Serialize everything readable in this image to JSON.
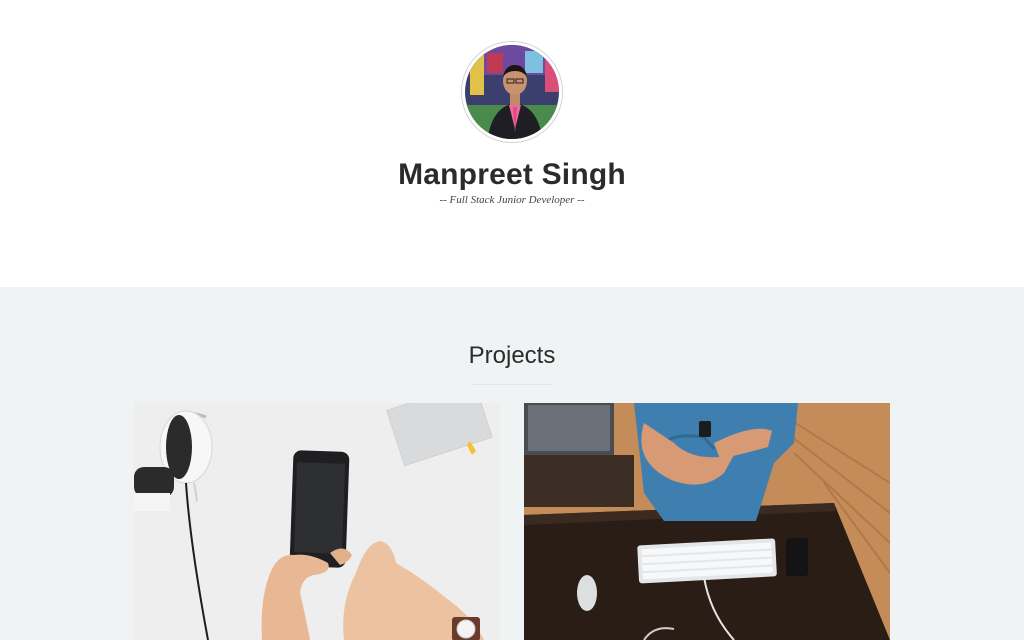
{
  "header": {
    "menu_icon": "hamburger-icon",
    "name": "Manpreet Singh",
    "tagline": "-- Full Stack Junior Developer --"
  },
  "projects": {
    "title": "Projects",
    "cards": [
      {
        "image": "headphones-phone-photo"
      },
      {
        "image": "desk-keyboard-photo"
      }
    ]
  },
  "colors": {
    "menu_button": "#9c9c9c",
    "section_bg": "#f0f3f4",
    "text": "#2b2b2b"
  }
}
